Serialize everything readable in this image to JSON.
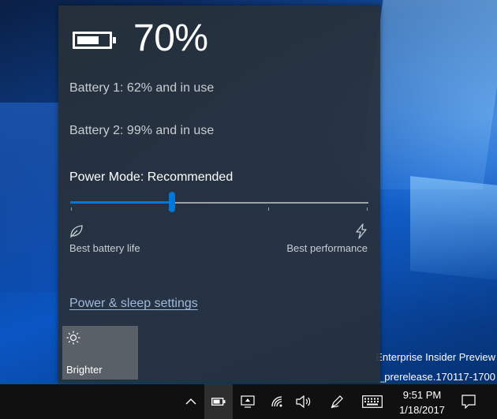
{
  "flyout": {
    "percent": "70%",
    "battery1": "Battery 1: 62% and in use",
    "battery2": "Battery 2: 99% and in use",
    "power_mode_title": "Power Mode: Recommended",
    "slider_position": 0.34,
    "left_label": "Best battery life",
    "right_label": "Best performance",
    "settings_link": "Power & sleep settings",
    "tile_label": "Brighter"
  },
  "watermark": {
    "line1": "Enterprise Insider Preview",
    "line2": "_prerelease.170117-1700"
  },
  "taskbar": {
    "time": "9:51 PM",
    "date": "1/18/2017"
  },
  "colors": {
    "accent": "#0078d7",
    "flyout_bg": "#28303a",
    "link": "#9fb9d8",
    "taskbar_bg": "#101010"
  },
  "icons": [
    "battery-icon",
    "leaf-icon",
    "bolt-icon",
    "brightness-icon",
    "chevron-up-icon",
    "battery-tray-icon",
    "projection-icon",
    "wifi-icon",
    "volume-icon",
    "pen-icon",
    "keyboard-icon",
    "action-center-icon"
  ]
}
